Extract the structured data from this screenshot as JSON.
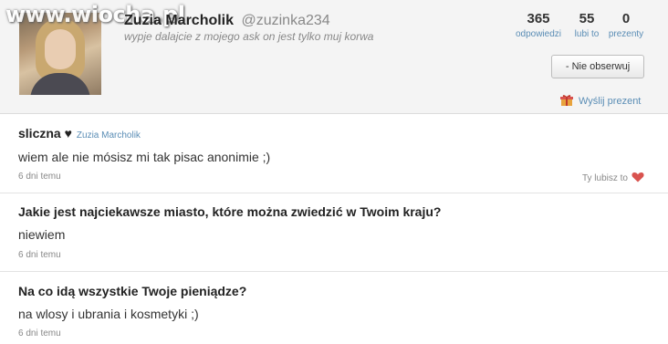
{
  "watermark": "www.wiocha.pl",
  "profile": {
    "name": "Zuzia Marcholik",
    "username": "@zuzinka234",
    "bio": "wypje dalajcie z mojego ask on jest tylko muj korwa"
  },
  "stats": [
    {
      "value": "365",
      "label": "odpowiedzi"
    },
    {
      "value": "55",
      "label": "lubi to"
    },
    {
      "value": "0",
      "label": "prezenty"
    }
  ],
  "actions": {
    "unfollow_label": "- Nie obserwuj",
    "gift_label": "Wyślij prezent"
  },
  "colors": {
    "link": "#5a8db5",
    "heart": "#d9534f"
  },
  "feed": [
    {
      "question": "sliczna ♥",
      "asker": "Zuzia Marcholik",
      "answer": "wiem ale nie mósisz mi tak pisac anonimie ;)",
      "time": "6 dni temu",
      "likes": "Ty lubisz to"
    },
    {
      "question": "Jakie jest najciekawsze miasto, które można zwiedzić w Twoim kraju?",
      "answer": "niewiem",
      "time": "6 dni temu"
    },
    {
      "question": "Na co idą wszystkie Twoje pieniądze?",
      "answer": "na wlosy i ubrania i kosmetyki ;)",
      "time": "6 dni temu"
    }
  ]
}
